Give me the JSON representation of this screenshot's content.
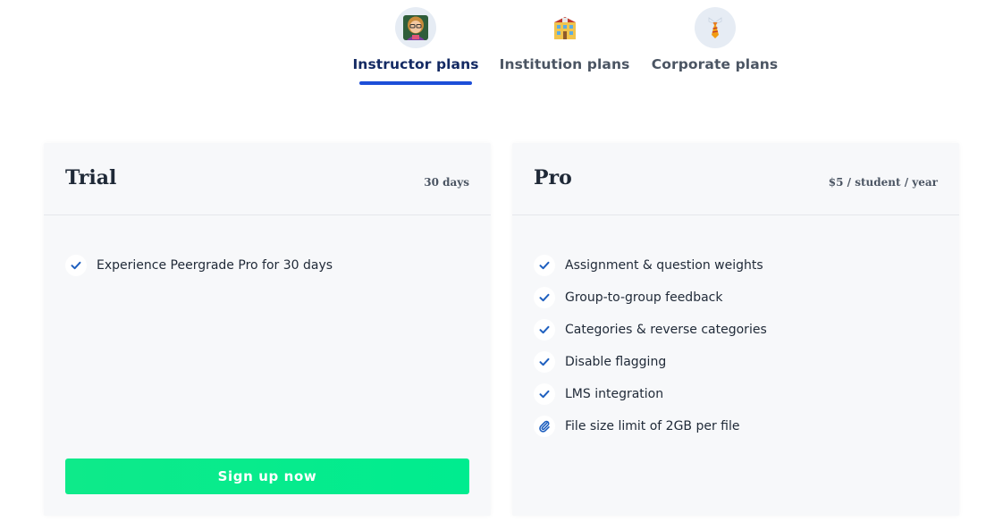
{
  "tabs": [
    {
      "label": "Instructor plans",
      "icon": "teacher-emoji-icon",
      "active": true
    },
    {
      "label": "Institution plans",
      "icon": "school-building-emoji-icon",
      "active": false
    },
    {
      "label": "Corporate plans",
      "icon": "necktie-emoji-icon",
      "active": false
    }
  ],
  "plans": {
    "trial": {
      "title": "Trial",
      "price": "30 days",
      "features": [
        {
          "text": "Experience Peergrade Pro for 30 days",
          "icon": "check-icon"
        }
      ],
      "cta_label": "Sign up now"
    },
    "pro": {
      "title": "Pro",
      "price": "$5 / student / year",
      "features": [
        {
          "text": "Assignment & question weights",
          "icon": "check-icon"
        },
        {
          "text": "Group-to-group feedback",
          "icon": "check-icon"
        },
        {
          "text": "Categories & reverse categories",
          "icon": "check-icon"
        },
        {
          "text": "Disable flagging",
          "icon": "check-icon"
        },
        {
          "text": "LMS integration",
          "icon": "check-icon"
        },
        {
          "text": "File size limit of 2GB per file",
          "icon": "paperclip-icon"
        }
      ]
    }
  },
  "colors": {
    "active_tab_text": "#142a63",
    "active_tab_underline": "#1d4ed8",
    "check": "#1e5fbf",
    "cta": "#00ec8f",
    "card_bg": "#f7f8fa"
  }
}
